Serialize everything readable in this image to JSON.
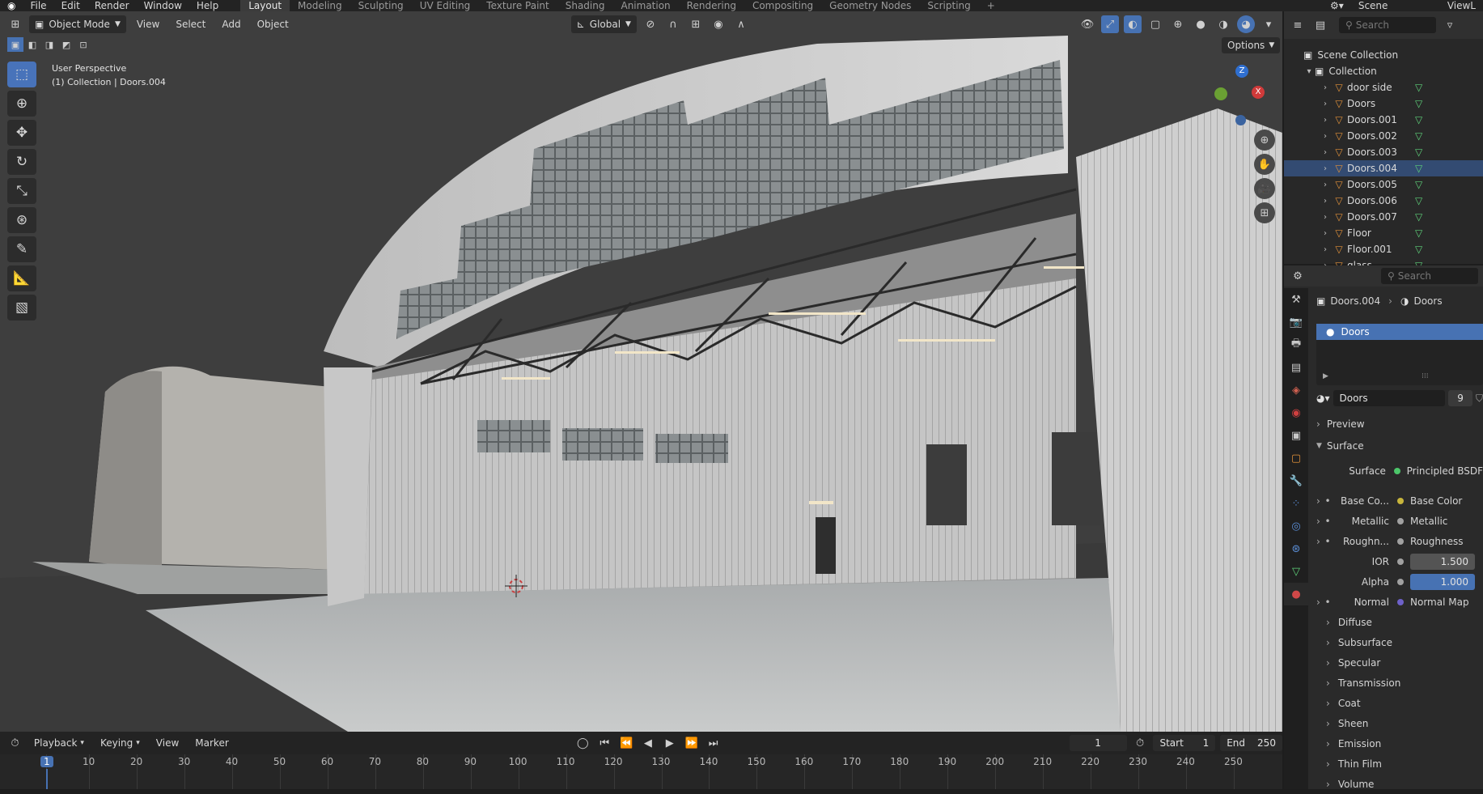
{
  "menu": {
    "file": "File",
    "edit": "Edit",
    "render": "Render",
    "window": "Window",
    "help": "Help",
    "workspaces": [
      "Layout",
      "Modeling",
      "Sculpting",
      "UV Editing",
      "Texture Paint",
      "Shading",
      "Animation",
      "Rendering",
      "Compositing",
      "Geometry Nodes",
      "Scripting"
    ],
    "add_tab": "+",
    "scene": "Scene",
    "view_layer": "ViewL"
  },
  "viewport": {
    "mode": "Object Mode",
    "view": "View",
    "select": "Select",
    "add": "Add",
    "object": "Object",
    "transform_orientation": "Global",
    "options": "Options",
    "overlay_title": "User Perspective",
    "overlay_subtitle": "(1) Collection | Doors.004",
    "gizmo_axes": {
      "z": "Z",
      "x": "X"
    }
  },
  "outliner": {
    "search_placeholder": "Search",
    "scene_collection": "Scene Collection",
    "collection": "Collection",
    "items": [
      "door side",
      "Doors",
      "Doors.001",
      "Doors.002",
      "Doors.003",
      "Doors.004",
      "Doors.005",
      "Doors.006",
      "Doors.007",
      "Floor",
      "Floor.001",
      "glass"
    ]
  },
  "properties": {
    "search_placeholder": "Search",
    "breadcrumb_object": "Doors.004",
    "breadcrumb_material": "Doors",
    "slot_selected": "Doors",
    "material_name": "Doors",
    "user_count": "9",
    "preview": "Preview",
    "surface": "Surface",
    "surface_label": "Surface",
    "surface_value": "Principled BSDF",
    "base_color_label": "Base Co...",
    "base_color_value": "Base Color",
    "metallic_label": "Metallic",
    "metallic_value": "Metallic",
    "roughness_label": "Roughn...",
    "roughness_value": "Roughness",
    "ior_label": "IOR",
    "ior_value": "1.500",
    "alpha_label": "Alpha",
    "alpha_value": "1.000",
    "normal_label": "Normal",
    "normal_value": "Normal Map",
    "panels": [
      "Diffuse",
      "Subsurface",
      "Specular",
      "Transmission",
      "Coat",
      "Sheen",
      "Emission",
      "Thin Film",
      "Volume"
    ],
    "colors": {
      "selected": "#4772b3",
      "base_color_dot": "#c7b53c",
      "normal_dot": "#6e61c9",
      "alpha_fill": "#4772b3"
    }
  },
  "timeline": {
    "playback": "Playback",
    "keying": "Keying",
    "view": "View",
    "marker": "Marker",
    "current_frame": "1",
    "start_label": "Start",
    "start": "1",
    "end_label": "End",
    "end": "250",
    "frames": [
      "1",
      "10",
      "20",
      "30",
      "40",
      "50",
      "60",
      "70",
      "80",
      "90",
      "100",
      "110",
      "120",
      "130",
      "140",
      "150",
      "160",
      "170",
      "180",
      "190",
      "200",
      "210",
      "220",
      "230",
      "240",
      "250"
    ]
  }
}
